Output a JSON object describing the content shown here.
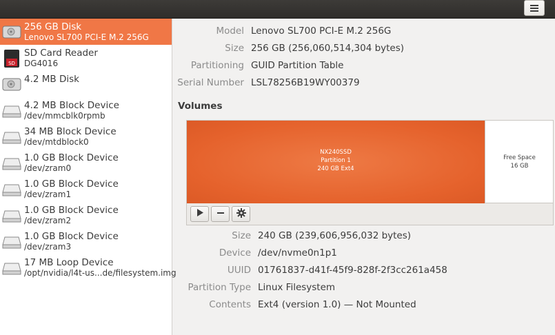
{
  "window": {
    "menu_icon": "hamburger-menu-icon"
  },
  "devices": [
    {
      "name": "256 GB Disk",
      "sub": "Lenovo SL700 PCI-E M.2 256G",
      "icon": "hard-disk-icon",
      "selected": true
    },
    {
      "name": "SD Card Reader",
      "sub": "DG4016",
      "icon": "sd-card-icon",
      "selected": false
    },
    {
      "name": "4.2 MB Disk",
      "sub": "",
      "icon": "hard-disk-icon",
      "selected": false
    },
    {
      "name": "4.2 MB Block Device",
      "sub": "/dev/mmcblk0rpmb",
      "icon": "block-device-icon",
      "selected": false
    },
    {
      "name": "34 MB Block Device",
      "sub": "/dev/mtdblock0",
      "icon": "block-device-icon",
      "selected": false
    },
    {
      "name": "1.0 GB Block Device",
      "sub": "/dev/zram0",
      "icon": "block-device-icon",
      "selected": false
    },
    {
      "name": "1.0 GB Block Device",
      "sub": "/dev/zram1",
      "icon": "block-device-icon",
      "selected": false
    },
    {
      "name": "1.0 GB Block Device",
      "sub": "/dev/zram2",
      "icon": "block-device-icon",
      "selected": false
    },
    {
      "name": "1.0 GB Block Device",
      "sub": "/dev/zram3",
      "icon": "block-device-icon",
      "selected": false
    },
    {
      "name": "17 MB Loop Device",
      "sub": "/opt/nvidia/l4t-us...de/filesystem.img",
      "icon": "block-device-icon",
      "selected": false
    }
  ],
  "disk_info": [
    {
      "label": "Model",
      "value": "Lenovo SL700 PCI-E M.2 256G"
    },
    {
      "label": "Size",
      "value": "256 GB (256,060,514,304 bytes)"
    },
    {
      "label": "Partitioning",
      "value": "GUID Partition Table"
    },
    {
      "label": "Serial Number",
      "value": "LSL78256B19WY00379"
    }
  ],
  "volumes": {
    "heading": "Volumes",
    "selected_partition": {
      "line1": "NX240SSD",
      "line2": "Partition 1",
      "line3": "240 GB Ext4"
    },
    "free_space": {
      "line1": "Free Space",
      "line2": "16 GB"
    },
    "toolbar": {
      "play": "play-icon",
      "minus": "minus-icon",
      "gear": "gear-icon"
    }
  },
  "partition_info": [
    {
      "label": "Size",
      "value": "240 GB (239,606,956,032 bytes)"
    },
    {
      "label": "Device",
      "value": "/dev/nvme0n1p1"
    },
    {
      "label": "UUID",
      "value": "01761837-d41f-45f9-828f-2f3cc261a458"
    },
    {
      "label": "Partition Type",
      "value": "Linux Filesystem"
    },
    {
      "label": "Contents",
      "value": "Ext4 (version 1.0) — Not Mounted"
    }
  ],
  "colors": {
    "accent": "#f07746",
    "partition": "#e5622c"
  }
}
